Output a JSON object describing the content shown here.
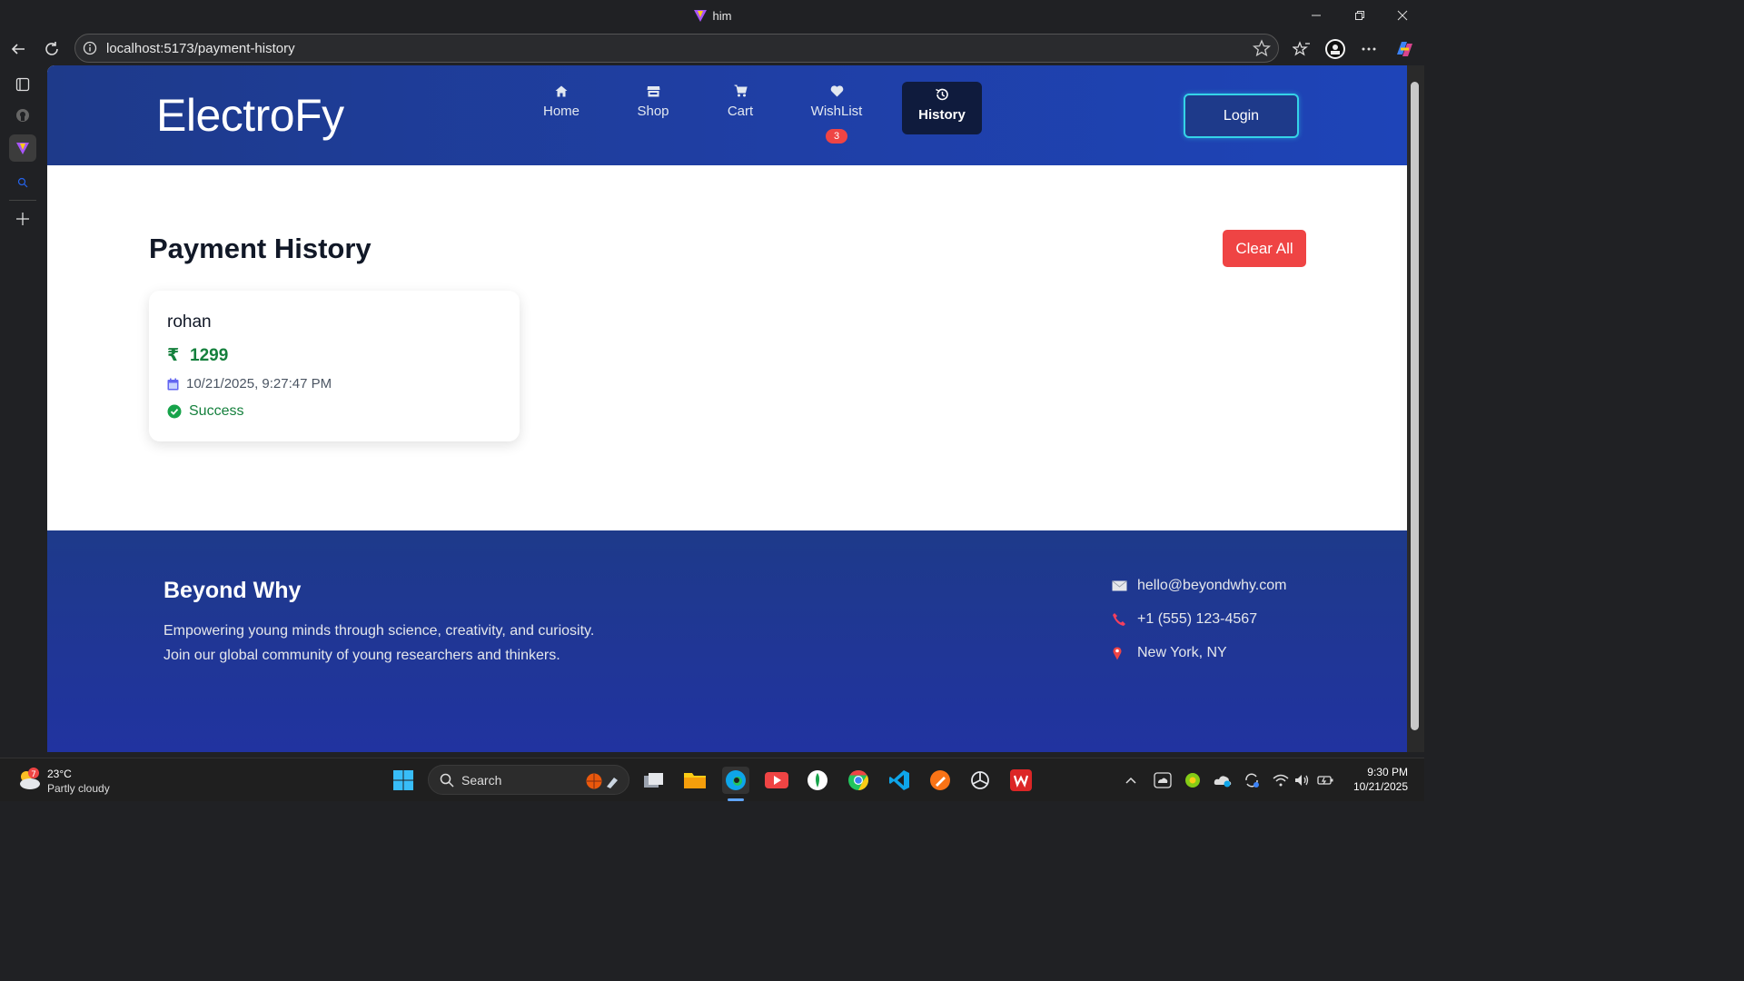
{
  "window": {
    "title": "him"
  },
  "browser": {
    "url": "localhost:5173/payment-history"
  },
  "site": {
    "brand": "ElectroFy",
    "nav": [
      {
        "label": "Home",
        "icon": "home-icon"
      },
      {
        "label": "Shop",
        "icon": "shop-icon"
      },
      {
        "label": "Cart",
        "icon": "cart-icon"
      },
      {
        "label": "WishList",
        "icon": "heart-icon",
        "badge": "3"
      },
      {
        "label": "History",
        "icon": "history-icon",
        "active": true
      }
    ],
    "login_label": "Login"
  },
  "main": {
    "title": "Payment History",
    "clear_label": "Clear All",
    "payments": [
      {
        "name": "rohan",
        "currency": "₹",
        "amount": "1299",
        "datetime": "10/21/2025, 9:27:47 PM",
        "status": "Success"
      }
    ]
  },
  "footer": {
    "title": "Beyond Why",
    "tagline_1": "Empowering young minds through science, creativity, and curiosity.",
    "tagline_2": "Join our global community of young researchers and thinkers.",
    "email": "hello@beyondwhy.com",
    "phone": "+1 (555) 123-4567",
    "location": "New York, NY"
  },
  "taskbar": {
    "weather_badge": "7",
    "temperature": "23°C",
    "condition": "Partly cloudy",
    "search_label": "Search",
    "time": "9:30 PM",
    "date": "10/21/2025"
  },
  "colors": {
    "header_blue": "#1e3a8a",
    "accent_red": "#ef4444",
    "success_green": "#15803d",
    "login_border": "#34d3e8"
  }
}
